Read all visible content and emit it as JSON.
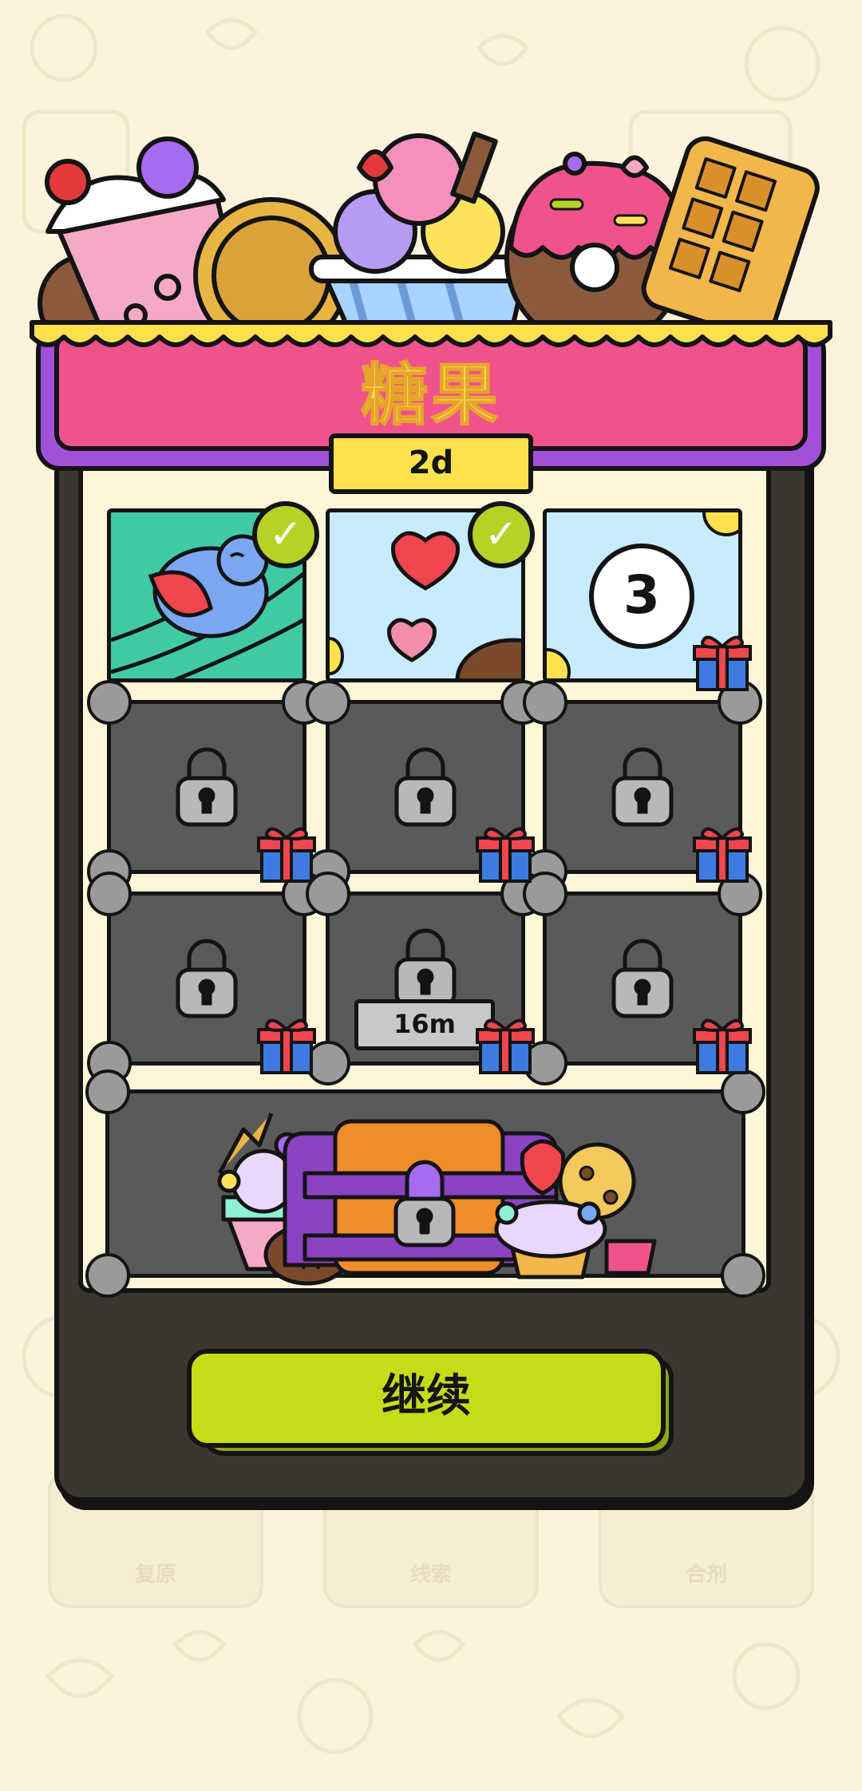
{
  "header": {
    "title": "糖果",
    "timer": "2d"
  },
  "grid": {
    "tiles": [
      {
        "state": "completed",
        "image": "bird-picture"
      },
      {
        "state": "completed",
        "image": "hearts-picture"
      },
      {
        "state": "current",
        "number": "3"
      },
      {
        "state": "locked"
      },
      {
        "state": "locked"
      },
      {
        "state": "locked"
      },
      {
        "state": "locked"
      },
      {
        "state": "locked",
        "timer": "16m"
      },
      {
        "state": "locked"
      }
    ],
    "chest": {
      "state": "locked"
    }
  },
  "continue_button": {
    "label": "继续"
  },
  "background_buttons": [
    "复原",
    "线索",
    "合剂"
  ],
  "colors": {
    "banner": "#f0538c",
    "title": "#ffd75a",
    "button": "#c6dc18",
    "frame": "#a151d8"
  }
}
